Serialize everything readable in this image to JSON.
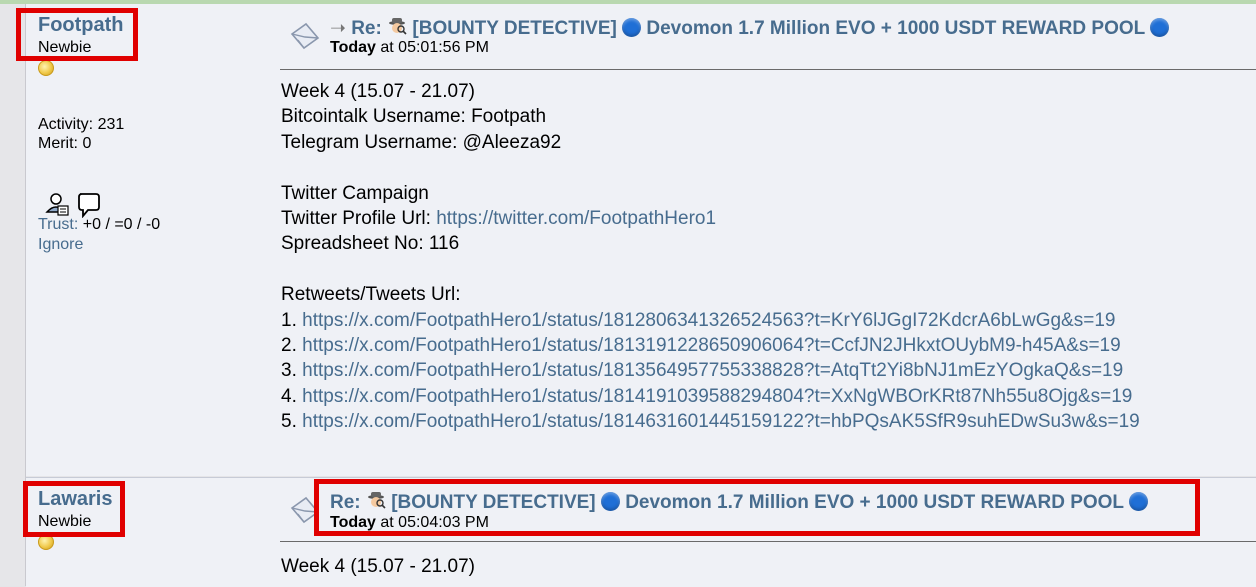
{
  "colors": {
    "link": "#476c8e",
    "highlight": "#e00000",
    "post_bg": "#eff1f6",
    "dot": "#1f6fd6"
  },
  "posts": [
    {
      "author": "Footpath",
      "rank": "Newbie",
      "activity": "Activity: 231",
      "merit": "Merit: 0",
      "trust_label": "Trust:",
      "trust_value": "+0 / =0 / -0",
      "ignore": "Ignore",
      "arrow": "➝",
      "subject_prefix": "Re:",
      "subject_main": "[BOUNTY DETECTIVE]",
      "subject_mid": "Devomon 1.7 Million EVO + 1000 USDT REWARD POOL",
      "date_day": "Today",
      "date_time": "at 05:01:56 PM",
      "lines": {
        "week": "Week 4  (15.07 - 21.07)",
        "bct": "Bitcointalk Username: Footpath",
        "tg": "Telegram Username: @Aleeza92",
        "campaign": "Twitter Campaign",
        "profile_label": "Twitter Profile Url:",
        "profile_url": "https://twitter.com/FootpathHero1",
        "sheet": "Spreadsheet No: 116",
        "rt_label": "Retweets/Tweets Url:"
      },
      "tweets": [
        {
          "n": "1.",
          "url": "https://x.com/FootpathHero1/status/1812806341326524563?t=KrY6lJGgI72KdcrA6bLwGg&s=19"
        },
        {
          "n": "2.",
          "url": "https://x.com/FootpathHero1/status/1813191228650906064?t=CcfJN2JHkxtOUybM9-h45A&s=19"
        },
        {
          "n": "3.",
          "url": "https://x.com/FootpathHero1/status/1813564957755338828?t=AtqTt2Yi8bNJ1mEzYOgkaQ&s=19"
        },
        {
          "n": "4.",
          "url": "https://x.com/FootpathHero1/status/1814191039588294804?t=XxNgWBOrKRt87Nh55u8Ojg&s=19"
        },
        {
          "n": "5.",
          "url": "https://x.com/FootpathHero1/status/1814631601445159122?t=hbPQsAK5SfR9suhEDwSu3w&s=19"
        }
      ]
    },
    {
      "author": "Lawaris",
      "rank": "Newbie",
      "subject_prefix": "Re:",
      "subject_main": "[BOUNTY DETECTIVE]",
      "subject_mid": "Devomon 1.7 Million EVO + 1000 USDT REWARD POOL",
      "date_day": "Today",
      "date_time": "at 05:04:03 PM",
      "week": "Week 4 (15.07 - 21.07)"
    }
  ]
}
